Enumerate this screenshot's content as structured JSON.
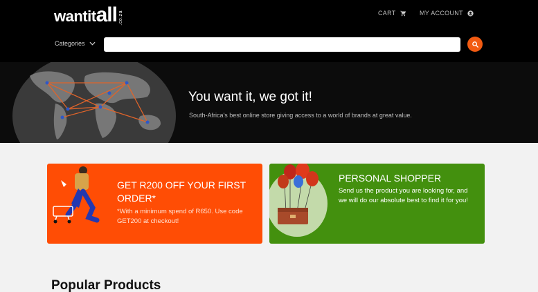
{
  "header": {
    "logo_text_main": "wantit",
    "logo_text_big": "all",
    "logo_tld": ".co.za",
    "cart_label": "CART",
    "account_label": "MY ACCOUNT",
    "categories_label": "Categories",
    "search_placeholder": ""
  },
  "hero": {
    "title": "You want it, we got it!",
    "subtitle": "South-Africa's best online store giving access to a world of brands at great value."
  },
  "promos": [
    {
      "title": "GET R200 OFF YOUR FIRST ORDER*",
      "body": "*With a minimum spend of R650. Use code GET200 at checkout!",
      "color": "#ff4d05"
    },
    {
      "title": "PERSONAL SHOPPER",
      "body": "Send us the product you are looking for, and we will do our absolute best to find it for you!",
      "color": "#43900e"
    }
  ],
  "sections": {
    "popular_title": "Popular Products"
  },
  "colors": {
    "accent": "#f25b12",
    "header_bg": "#000000"
  }
}
